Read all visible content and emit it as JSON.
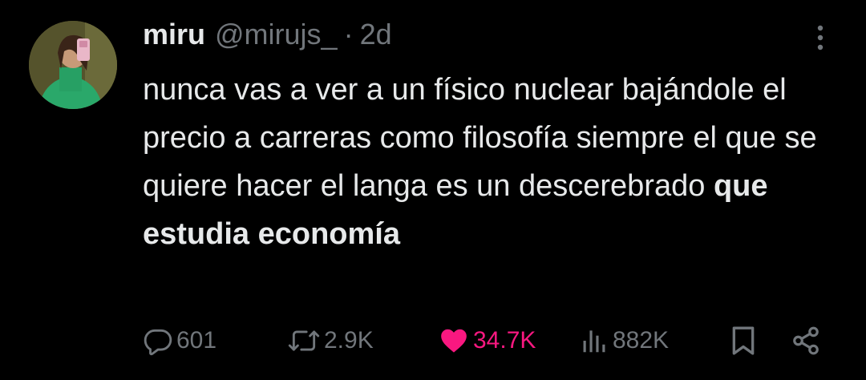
{
  "tweet": {
    "name": "miru",
    "handle": "@mirujs_",
    "separator": "·",
    "time": "2d",
    "text_regular": "nunca vas a ver a un físico nuclear bajándole el precio a carreras como filosofía siempre el que se quiere hacer el langa es un descerebrado ",
    "text_bold": "que estudia economía"
  },
  "stats": {
    "replies": "601",
    "reposts": "2.9K",
    "likes": "34.7K",
    "views": "882K"
  },
  "colors": {
    "background": "#000000",
    "text": "#e7e9ea",
    "secondary": "#71767b",
    "like_active": "#f91880"
  },
  "icons": {
    "more": "more-vertical-icon",
    "reply": "reply-icon",
    "repost": "repost-icon",
    "like": "heart-filled-icon",
    "views": "views-icon",
    "bookmark": "bookmark-icon",
    "share": "share-icon"
  }
}
